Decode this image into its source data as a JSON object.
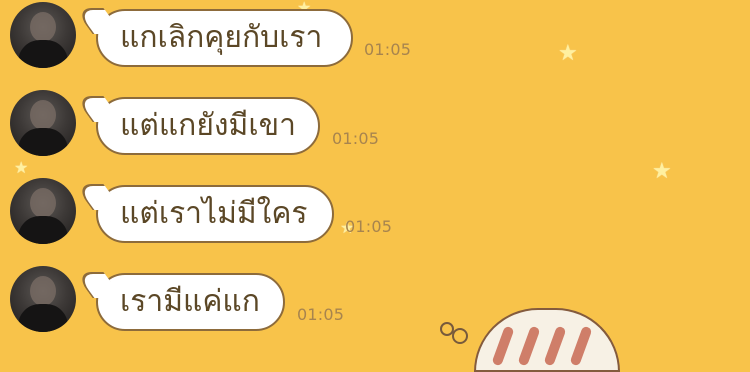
{
  "background_color": "#f8c34a",
  "bubble_border_color": "#8d6b3b",
  "text_color": "#5b4726",
  "time_color": "#a7844e",
  "messages": [
    {
      "text": "แกเลิกคุยกับเรา",
      "time": "01:05",
      "avatar": "avatar"
    },
    {
      "text": "แต่แกยังมีเขา",
      "time": "01:05",
      "avatar": "avatar"
    },
    {
      "text": "แต่เราไม่มีใคร",
      "time": "01:05",
      "avatar": "avatar"
    },
    {
      "text": "เรามีแค่แก",
      "time": "01:05",
      "avatar": "avatar"
    }
  ],
  "decorations": {
    "stars": [
      "star-icon",
      "star-icon",
      "star-icon",
      "star-icon",
      "star-icon"
    ],
    "sticker": "sticker-icon"
  }
}
